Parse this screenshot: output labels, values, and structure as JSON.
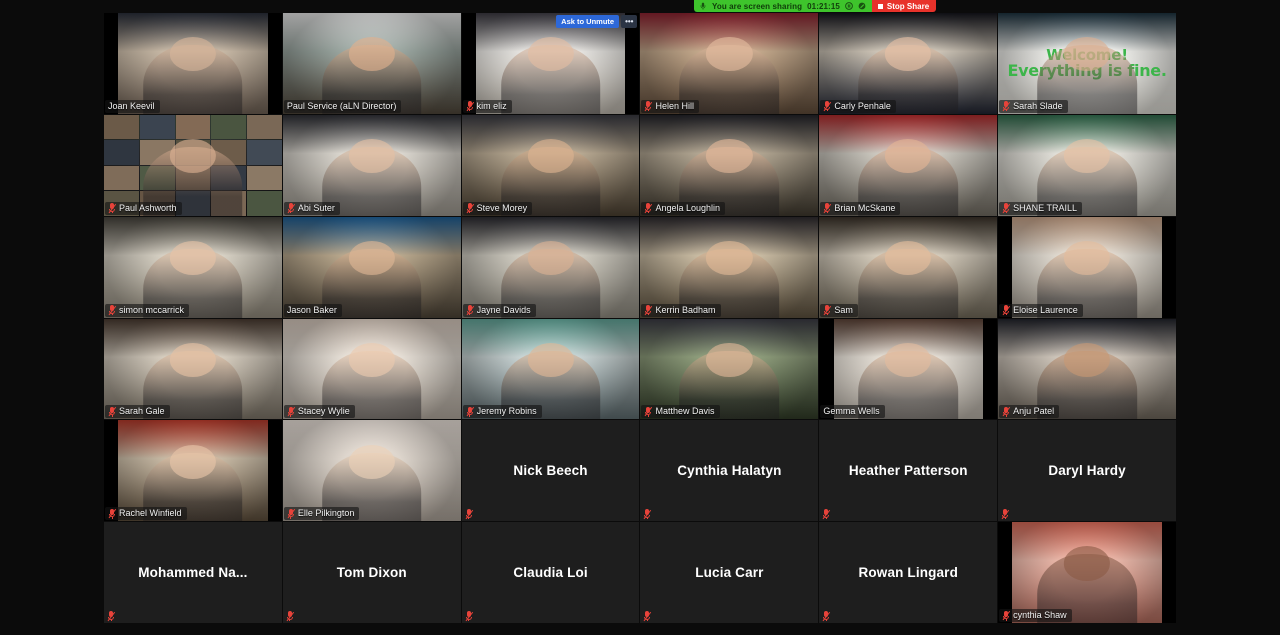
{
  "app": "Zoom Meeting - Gallery View",
  "share_bar": {
    "status_text": "You are screen sharing",
    "timer": "01:21:15",
    "stop_label": "Stop Share",
    "icons": [
      "microphone-icon",
      "pause-icon",
      "annotate-icon",
      "stop-square-icon"
    ],
    "green": "#3ec42c",
    "red": "#e8322b"
  },
  "grid": {
    "columns": 6,
    "rows": 6
  },
  "hover_controls": {
    "ask_to_unmute_label": "Ask to Unmute",
    "more_label": "•••"
  },
  "virtual_background_text": {
    "line1": "Welcome!",
    "line2": "Everything is fine."
  },
  "participants": [
    {
      "name": "Joan Keevil",
      "video": true,
      "muted": false,
      "active": false,
      "skin": "#d7b49a",
      "bg1": "#c8b9a6",
      "bg2": "#6d5f53",
      "top": "#2a2f3a",
      "pillars": true
    },
    {
      "name": "Paul Service (aLN Director)",
      "video": true,
      "muted": false,
      "active": true,
      "skin": "#e0b08c",
      "bg1": "#9aa6a0",
      "bg2": "#4d4438",
      "top": "#e8e8e8"
    },
    {
      "name": "kim eliz",
      "video": true,
      "muted": true,
      "active": false,
      "skin": "#e4bda2",
      "bg1": "#e7e5e1",
      "bg2": "#b9b3a9",
      "top": "#3c3a42",
      "hover": true,
      "pillars": true
    },
    {
      "name": "Helen Hill",
      "video": true,
      "muted": true,
      "active": false,
      "skin": "#e3bb9e",
      "bg1": "#c4a98c",
      "bg2": "#5e4a38",
      "top": "#8d2230"
    },
    {
      "name": "Carly Penhale",
      "video": true,
      "muted": true,
      "active": false,
      "skin": "#e6c0a4",
      "bg1": "#cfc6b8",
      "bg2": "#1f2330",
      "top": "#14151c"
    },
    {
      "name": "Sarah Slade",
      "video": true,
      "muted": true,
      "active": false,
      "skin": "#dcae90",
      "bg1": "#f2f2ee",
      "bg2": "#d8d6cf",
      "top": "#1d3340",
      "vb": true
    },
    {
      "name": "Paul Ashworth",
      "video": true,
      "muted": true,
      "active": false,
      "skin": "#ddb193",
      "bg1": "#2a2a2c",
      "bg2": "#121214",
      "top": "#3c4a3d",
      "thumbs": true
    },
    {
      "name": "Abi Suter",
      "video": true,
      "muted": true,
      "active": false,
      "skin": "#e5c0a3",
      "bg1": "#dcd8d0",
      "bg2": "#9a958c",
      "top": "#2e2f35"
    },
    {
      "name": "Steve Morey",
      "video": true,
      "muted": true,
      "active": false,
      "skin": "#ddb38f",
      "bg1": "#b9aa93",
      "bg2": "#4a3f30",
      "top": "#3a3b42"
    },
    {
      "name": "Angela Loughlin",
      "video": true,
      "muted": true,
      "active": false,
      "skin": "#e3b89a",
      "bg1": "#b3a793",
      "bg2": "#3e382d",
      "top": "#24242a"
    },
    {
      "name": "Brian McSkane",
      "video": true,
      "muted": true,
      "active": false,
      "skin": "#e3b495",
      "bg1": "#cfcbc2",
      "bg2": "#6f6a60",
      "top": "#b22a2c"
    },
    {
      "name": "SHANE TRAILL",
      "video": true,
      "muted": true,
      "active": false,
      "skin": "#e7c2a4",
      "bg1": "#e3e1da",
      "bg2": "#a7a49b",
      "top": "#2f6b4c"
    },
    {
      "name": "simon mccarrick",
      "video": true,
      "muted": true,
      "active": false,
      "skin": "#e8c3a6",
      "bg1": "#d9d3c6",
      "bg2": "#8e8779",
      "top": "#46433c"
    },
    {
      "name": "Jason Baker",
      "video": true,
      "muted": false,
      "active": false,
      "skin": "#dfb694",
      "bg1": "#b9a88d",
      "bg2": "#4b4235",
      "top": "#1e5f96"
    },
    {
      "name": "Jayne Davids",
      "video": true,
      "muted": true,
      "active": false,
      "skin": "#dcb293",
      "bg1": "#d3cfc4",
      "bg2": "#8c887d",
      "top": "#2b2b31"
    },
    {
      "name": "Kerrin Badham",
      "video": true,
      "muted": true,
      "active": false,
      "skin": "#e2b996",
      "bg1": "#cbbda4",
      "bg2": "#5b4f3c",
      "top": "#2e2b2f"
    },
    {
      "name": "Sam",
      "video": true,
      "muted": true,
      "active": false,
      "skin": "#e5bd9b",
      "bg1": "#d6cdbd",
      "bg2": "#6f6757",
      "top": "#3a3229"
    },
    {
      "name": "Eloise Laurence",
      "video": true,
      "muted": true,
      "active": false,
      "skin": "#e4bb9b",
      "bg1": "#e0dad0",
      "bg2": "#9c958a",
      "top": "#c9a489",
      "pillars": true
    },
    {
      "name": "Sarah Gale",
      "video": true,
      "muted": true,
      "active": false,
      "skin": "#e6c1a3",
      "bg1": "#d7cec0",
      "bg2": "#7b7366",
      "top": "#4a3b31"
    },
    {
      "name": "Stacey Wylie",
      "video": true,
      "muted": true,
      "active": false,
      "skin": "#eccaae",
      "bg1": "#e6dfd6",
      "bg2": "#b0a79c",
      "top": "#d7c9bd"
    },
    {
      "name": "Jeremy Robins",
      "video": true,
      "muted": true,
      "active": false,
      "skin": "#e0b694",
      "bg1": "#c9d4d4",
      "bg2": "#5c6a6d",
      "top": "#62a79a"
    },
    {
      "name": "Matthew Davis",
      "video": true,
      "muted": true,
      "active": false,
      "skin": "#e1b797",
      "bg1": "#8f9e7c",
      "bg2": "#2f3a26",
      "top": "#3b3b44"
    },
    {
      "name": "Gemma Wells",
      "video": true,
      "muted": false,
      "active": false,
      "skin": "#e3bb9c",
      "bg1": "#e4ded5",
      "bg2": "#b5aea4",
      "top": "#5e4438",
      "pillars": true
    },
    {
      "name": "Anju Patel",
      "video": true,
      "muted": true,
      "active": false,
      "skin": "#c89773",
      "bg1": "#cfc6bb",
      "bg2": "#6c6459",
      "top": "#22242c"
    },
    {
      "name": "Rachel Winfield",
      "video": true,
      "muted": true,
      "active": false,
      "skin": "#e8c5a8",
      "bg1": "#c7b9a4",
      "bg2": "#5b4c3a",
      "top": "#b83a2b",
      "pillars": true
    },
    {
      "name": "Elle Pilkington",
      "video": true,
      "muted": true,
      "active": false,
      "skin": "#ecd0b6",
      "bg1": "#ddd5cc",
      "bg2": "#a89f95",
      "top": "#efe6de"
    },
    {
      "name": "Nick Beech",
      "video": false,
      "muted": true,
      "active": false
    },
    {
      "name": "Cynthia Halatyn",
      "video": false,
      "muted": true,
      "active": false
    },
    {
      "name": "Heather Patterson",
      "video": false,
      "muted": true,
      "active": false
    },
    {
      "name": "Daryl Hardy",
      "video": false,
      "muted": true,
      "active": false
    },
    {
      "name": "Mohammed  Na...",
      "video": false,
      "muted": true,
      "active": false
    },
    {
      "name": "Tom Dixon",
      "video": false,
      "muted": true,
      "active": false
    },
    {
      "name": "Claudia Loi",
      "video": false,
      "muted": true,
      "active": false
    },
    {
      "name": "Lucia Carr",
      "video": false,
      "muted": true,
      "active": false
    },
    {
      "name": "Rowan Lingard",
      "video": false,
      "muted": true,
      "active": false
    },
    {
      "name": "cynthia Shaw",
      "video": true,
      "muted": true,
      "active": false,
      "skin": "#8a5a45",
      "bg1": "#e8b6a8",
      "bg2": "#b06a5c",
      "top": "#d96a58",
      "pillars": true
    }
  ]
}
